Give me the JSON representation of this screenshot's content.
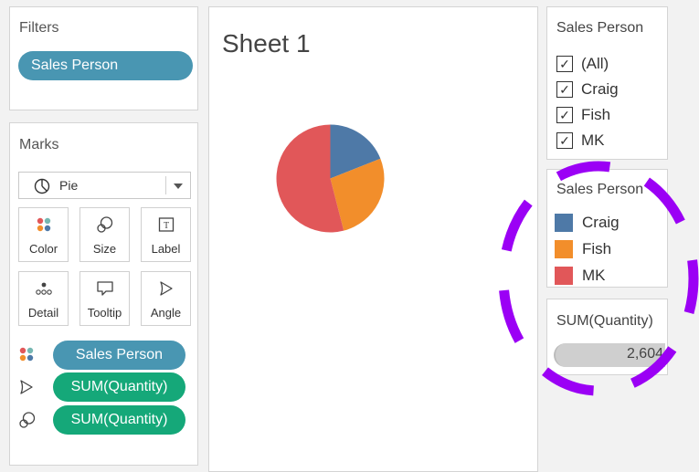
{
  "filters": {
    "title": "Filters",
    "pill": "Sales Person"
  },
  "marks": {
    "title": "Marks",
    "type": "Pie",
    "buttons": [
      {
        "label": "Color",
        "icon": "color-dots-icon"
      },
      {
        "label": "Size",
        "icon": "size-icon"
      },
      {
        "label": "Label",
        "icon": "label-icon"
      },
      {
        "label": "Detail",
        "icon": "detail-icon"
      },
      {
        "label": "Tooltip",
        "icon": "tooltip-icon"
      },
      {
        "label": "Angle",
        "icon": "angle-icon"
      }
    ],
    "fields": [
      {
        "label": "Sales Person",
        "icon": "color-dots-icon",
        "color": "#4996b2"
      },
      {
        "label": "SUM(Quantity)",
        "icon": "angle-icon",
        "color": "#15a879"
      },
      {
        "label": "SUM(Quantity)",
        "icon": "size-icon",
        "color": "#15a879"
      }
    ]
  },
  "sheet": {
    "title": "Sheet 1"
  },
  "chart_data": {
    "type": "pie",
    "categories": [
      "Craig",
      "Fish",
      "MK"
    ],
    "values": [
      0.19,
      0.27,
      0.54
    ],
    "colors": [
      "#4e79a7",
      "#f28e2b",
      "#e15759"
    ]
  },
  "filter_card": {
    "title": "Sales Person",
    "items": [
      {
        "label": "(All)",
        "checked": true
      },
      {
        "label": "Craig",
        "checked": true
      },
      {
        "label": "Fish",
        "checked": true
      },
      {
        "label": "MK",
        "checked": true
      }
    ]
  },
  "legend": {
    "title": "Sales Person",
    "items": [
      {
        "label": "Craig",
        "color": "#4e79a7"
      },
      {
        "label": "Fish",
        "color": "#f28e2b"
      },
      {
        "label": "MK",
        "color": "#e15759"
      }
    ]
  },
  "size_legend": {
    "title": "SUM(Quantity)",
    "value": "2,604"
  },
  "annotation": {
    "color": "#9b00f5"
  }
}
